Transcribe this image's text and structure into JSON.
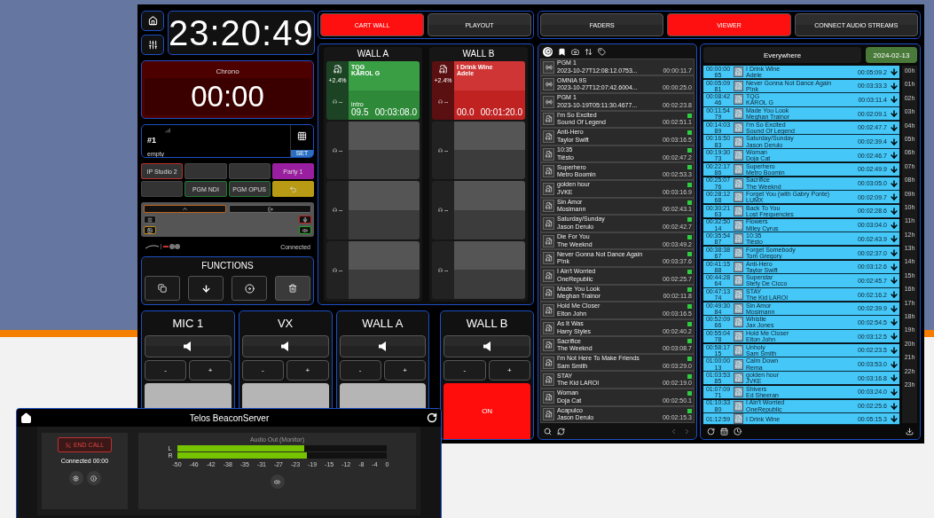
{
  "clock": {
    "time": "23:20:49"
  },
  "chrono": {
    "label": "Chrono",
    "time": "00:00"
  },
  "phone": {
    "line": "#1",
    "status": "empty",
    "button": "SET"
  },
  "codecs": [
    {
      "kind": "line",
      "label": "IP Studio 2",
      "color": "#b8322c"
    },
    {
      "kind": "blank"
    },
    {
      "kind": "blank"
    },
    {
      "kind": "party",
      "label": "Party 1",
      "color": "#9a1fa0"
    },
    {
      "kind": "blank"
    },
    {
      "kind": "line",
      "label": "PGM NDI",
      "color": "#1f7a35"
    },
    {
      "kind": "line",
      "label": "PGM OPUS",
      "color": "#1f7a35"
    },
    {
      "kind": "back",
      "color": "#b89a14"
    }
  ],
  "connection_status": "Connected",
  "functions": {
    "title": "FUNCTIONS"
  },
  "mode_tabs": [
    {
      "label": "CART WALL",
      "selected": true
    },
    {
      "label": "PLAYOUT",
      "selected": false
    }
  ],
  "walls": [
    {
      "title": "WALL A",
      "slots": [
        {
          "kind": "cart",
          "playing": false,
          "title": "TQG",
          "artist": "KAROL G",
          "pitch": "+2.4%",
          "intro_label": "intro",
          "intro": "09.5",
          "duration": "00:03:08.0",
          "monitor": "--"
        },
        {
          "kind": "empty",
          "monitor": "--"
        },
        {
          "kind": "empty",
          "monitor": "--"
        },
        {
          "kind": "empty",
          "monitor": "--"
        }
      ]
    },
    {
      "title": "WALL B",
      "slots": [
        {
          "kind": "cart",
          "playing": true,
          "title": "I Drink Wine",
          "artist": "Adele",
          "pitch": "+2.4%",
          "intro": "00.0",
          "duration": "00:01:20.0",
          "monitor": "--"
        },
        {
          "kind": "empty",
          "monitor": "--"
        },
        {
          "kind": "empty",
          "monitor": "--"
        },
        {
          "kind": "empty",
          "monitor": "--"
        }
      ]
    }
  ],
  "channels": [
    {
      "name": "MIC 1",
      "minus": "-",
      "plus": "+",
      "on": false
    },
    {
      "name": "VX",
      "minus": "-",
      "plus": "+",
      "on": false
    },
    {
      "name": "WALL A",
      "minus": "-",
      "plus": "+",
      "on": false
    },
    {
      "name": "WALL B",
      "minus": "-",
      "plus": "+",
      "on": true,
      "button_label": "ON"
    }
  ],
  "view_tabs": [
    {
      "label": "FADERS",
      "selected": false
    },
    {
      "label": "VIEWER",
      "selected": true
    },
    {
      "label": "CONNECT AUDIO STREAMS",
      "selected": false
    }
  ],
  "library": {
    "items": [
      {
        "kind": "stream",
        "title": "PGM 1",
        "subtitle": "2023-10-27T12:08:12.0753...",
        "duration": "00:00:11.7"
      },
      {
        "kind": "stream",
        "title": "OMNIA 9S",
        "subtitle": "2023-10-27T12:07:42.6004...",
        "duration": "00:00:25.0"
      },
      {
        "kind": "stream",
        "title": "PGM 1",
        "subtitle": "2023-10-19T05:11:30.4677...",
        "duration": "00:02:23.8"
      },
      {
        "kind": "file",
        "title": "I'm So Excited",
        "subtitle": "Sound Of Legend",
        "duration": "00:02:51.1"
      },
      {
        "kind": "file",
        "title": "Anti-Hero",
        "subtitle": "Taylor Swift",
        "duration": "00:03:16.5"
      },
      {
        "kind": "file",
        "title": "10:35",
        "subtitle": "Tiësto",
        "duration": "00:02:47.2"
      },
      {
        "kind": "file",
        "title": "Superhero",
        "subtitle": "Metro Boomin",
        "duration": "00:02:53.3"
      },
      {
        "kind": "file",
        "title": "golden hour",
        "subtitle": "JVKE",
        "duration": "00:03:16.9"
      },
      {
        "kind": "file",
        "title": "Sin Amor",
        "subtitle": "Mosimann",
        "duration": "00:02:43.1"
      },
      {
        "kind": "file",
        "title": "Saturday/Sunday",
        "subtitle": "Jason Derulo",
        "duration": "00:02:42.7"
      },
      {
        "kind": "file",
        "title": "Die For You",
        "subtitle": "The Weeknd",
        "duration": "00:03:49.2"
      },
      {
        "kind": "file",
        "title": "Never Gonna Not Dance Again",
        "subtitle": "P!nk",
        "duration": "00:03:37.6"
      },
      {
        "kind": "file",
        "title": "I Ain't Worried",
        "subtitle": "OneRepublic",
        "duration": "00:02:25.7"
      },
      {
        "kind": "file",
        "title": "Made You Look",
        "subtitle": "Meghan Trainor",
        "duration": "00:02:11.8"
      },
      {
        "kind": "file",
        "title": "Hold Me Closer",
        "subtitle": "Elton John",
        "duration": "00:03:16.5"
      },
      {
        "kind": "file",
        "title": "As It Was",
        "subtitle": "Harry Styles",
        "duration": "00:02:40.2"
      },
      {
        "kind": "file",
        "title": "Sacrifice",
        "subtitle": "The Weeknd",
        "duration": "00:03:08.7"
      },
      {
        "kind": "file",
        "title": "I'm Not Here To Make Friends",
        "subtitle": "Sam Smith",
        "duration": "00:03:29.0"
      },
      {
        "kind": "file",
        "title": "STAY",
        "subtitle": "The Kid LAROI",
        "duration": "00:02:19.0"
      },
      {
        "kind": "file",
        "title": "Woman",
        "subtitle": "Doja Cat",
        "duration": "00:02:50.1"
      },
      {
        "kind": "file",
        "title": "Acapulco",
        "subtitle": "Jason Derulo",
        "duration": "00:02:15.3"
      }
    ]
  },
  "viewer": {
    "scope": "Everywhere",
    "date": "2024-02-13",
    "rows": [
      {
        "time": "00:00:00",
        "number": "65",
        "title": "I Drink Wine",
        "artist": "Adele",
        "duration": "00:05:09.2"
      },
      {
        "time": "00:05:09",
        "number": "81",
        "title": "Never Gonna Not Dance Again",
        "artist": "P!nk",
        "duration": "00:03:33.3"
      },
      {
        "time": "00:08:42",
        "number": "46",
        "title": "TQG",
        "artist": "KAROL G",
        "duration": "00:03:11.4"
      },
      {
        "time": "00:11:54",
        "number": "79",
        "title": "Made You Look",
        "artist": "Meghan Trainor",
        "duration": "00:02:09.1"
      },
      {
        "time": "00:14:03",
        "number": "89",
        "title": "I'm So Excited",
        "artist": "Sound Of Legend",
        "duration": "00:02:47.7"
      },
      {
        "time": "00:16:50",
        "number": "83",
        "title": "Saturday/Sunday",
        "artist": "Jason Derulo",
        "duration": "00:02:39.4"
      },
      {
        "time": "00:19:30",
        "number": "73",
        "title": "Woman",
        "artist": "Doja Cat",
        "duration": "00:02:46.7"
      },
      {
        "time": "00:22:17",
        "number": "86",
        "title": "Superhero",
        "artist": "Metro Boomin",
        "duration": "00:02:49.9"
      },
      {
        "time": "00:25:07",
        "number": "76",
        "title": "Sacrifice",
        "artist": "The Weeknd",
        "duration": "00:03:05.0"
      },
      {
        "time": "00:28:12",
        "number": "68",
        "title": "Forget You (with Gabry Ponte)",
        "artist": "LUMX",
        "duration": "00:02:09.7"
      },
      {
        "time": "00:30:21",
        "number": "63",
        "title": "Back To You",
        "artist": "Lost Frequencies",
        "duration": "00:02:28.6"
      },
      {
        "time": "00:32:50",
        "number": "14",
        "title": "Flowers",
        "artist": "Miley Cyrus",
        "duration": "00:03:04.0"
      },
      {
        "time": "00:35:54",
        "number": "87",
        "title": "10:35",
        "artist": "Tiësto",
        "duration": "00:02:43.9"
      },
      {
        "time": "00:38:38",
        "number": "67",
        "title": "Forget Somebody",
        "artist": "Tom Gregory",
        "duration": "00:02:37.0"
      },
      {
        "time": "00:41:15",
        "number": "88",
        "title": "Anti-Hero",
        "artist": "Taylor Swift",
        "duration": "00:03:12.6"
      },
      {
        "time": "00:44:28",
        "number": "64",
        "title": "Superstar",
        "artist": "Stefy De Cicco",
        "duration": "00:02:45.7"
      },
      {
        "time": "00:47:13",
        "number": "74",
        "title": "STAY",
        "artist": "The Kid LAROI",
        "duration": "00:02:16.2"
      },
      {
        "time": "00:49:30",
        "number": "84",
        "title": "Sin Amor",
        "artist": "Mosimann",
        "duration": "00:02:39.9"
      },
      {
        "time": "00:52:09",
        "number": "66",
        "title": "Whistle",
        "artist": "Jax Jones",
        "duration": "00:02:54.5"
      },
      {
        "time": "00:55:04",
        "number": "78",
        "title": "Hold Me Closer",
        "artist": "Elton John",
        "duration": "00:03:12.5"
      },
      {
        "time": "00:58:17",
        "number": "15",
        "title": "Unholy",
        "artist": "Sam Smith",
        "duration": "00:02:23.5"
      },
      {
        "time": "01:00:00",
        "number": "13",
        "title": "Calm Down",
        "artist": "Rema",
        "duration": "00:03:53.0"
      },
      {
        "time": "01:03:53",
        "number": "85",
        "title": "golden hour",
        "artist": "JVKE",
        "duration": "00:03:16.8"
      },
      {
        "time": "01:07:09",
        "number": "71",
        "title": "Shivers",
        "artist": "Ed Sheeran",
        "duration": "00:03:24.0"
      },
      {
        "time": "01:10:33",
        "number": "80",
        "title": "I Ain't Worried",
        "artist": "OneRepublic",
        "duration": "00:02:25.6"
      },
      {
        "time": "01:12:59",
        "title": "I Drink Wine",
        "duration": "00:05:15.3"
      }
    ],
    "hours": [
      "00h",
      "01h",
      "02h",
      "03h",
      "04h",
      "05h",
      "06h",
      "07h",
      "08h",
      "09h",
      "10h",
      "11h",
      "12h",
      "13h",
      "14h",
      "15h",
      "16h",
      "17h",
      "18h",
      "19h",
      "20h",
      "21h",
      "22h",
      "23h"
    ]
  },
  "beacon": {
    "title": "Telos BeaconServer",
    "end_call": "END CALL",
    "status": "Connected 00:00",
    "meter_title": "Audio Out (Monitor)",
    "meters": [
      {
        "label": "L",
        "level": 0.61
      },
      {
        "label": "R",
        "level": 0.62
      }
    ],
    "ticks": [
      "-50",
      "-46",
      "-42",
      "-38",
      "-35",
      "-31",
      "-27",
      "-23",
      "-19",
      "-15",
      "-12",
      "-8",
      "-4",
      "0"
    ]
  }
}
